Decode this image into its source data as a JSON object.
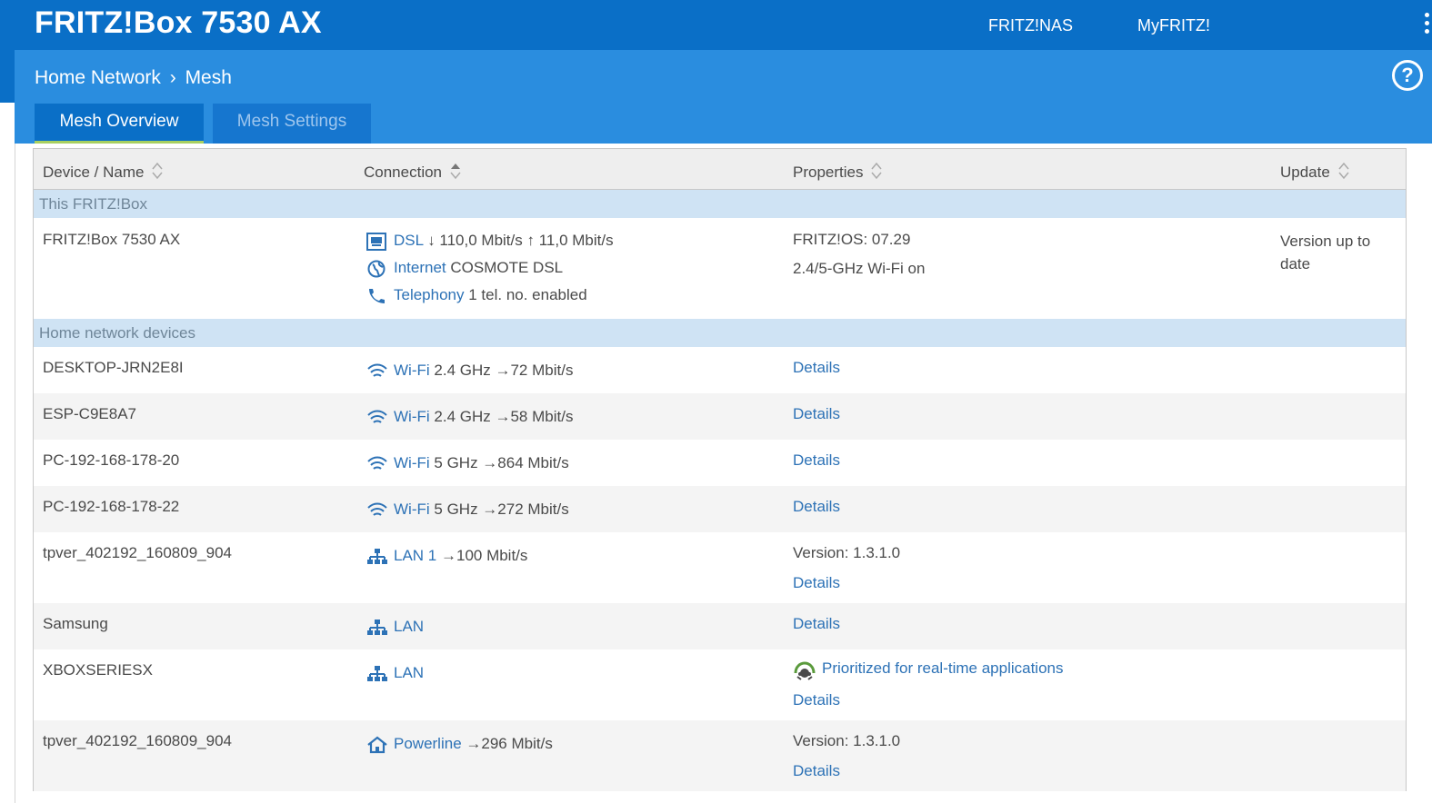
{
  "app": {
    "title": "FRITZ!Box 7530 AX"
  },
  "topnav": {
    "fritznas": "FRITZ!NAS",
    "myfritz": "MyFRITZ!"
  },
  "breadcrumb": {
    "parent": "Home Network",
    "separator": "›",
    "current": "Mesh"
  },
  "help": {
    "label": "?"
  },
  "tabs": [
    {
      "label": "Mesh Overview",
      "active": true
    },
    {
      "label": "Mesh Settings",
      "active": false
    }
  ],
  "table": {
    "headers": {
      "device": "Device / Name",
      "connection": "Connection",
      "properties": "Properties",
      "update": "Update"
    },
    "sections": {
      "this_box": "This FRITZ!Box",
      "home_devices": "Home network devices"
    },
    "fritzbox": {
      "name": "FRITZ!Box 7530 AX",
      "conn": [
        {
          "icon": "dsl-icon",
          "label": "DSL",
          "value": "↓ 110,0 Mbit/s ↑ 11,0 Mbit/s"
        },
        {
          "icon": "globe-icon",
          "label": "Internet",
          "value": "COSMOTE DSL"
        },
        {
          "icon": "phone-icon",
          "label": "Telephony",
          "value": "1 tel. no. enabled"
        }
      ],
      "props": [
        "FRITZ!OS: 07.29",
        "2.4/5-GHz Wi-Fi on"
      ],
      "update": "Version up to date"
    },
    "devices": [
      {
        "name": "DESKTOP-JRN2E8I",
        "icon": "wifi-icon",
        "label": "Wi-Fi",
        "value": "2.4 GHz →72 Mbit/s",
        "props": [],
        "details": "Details"
      },
      {
        "name": "ESP-C9E8A7",
        "icon": "wifi-icon",
        "label": "Wi-Fi",
        "value": "2.4 GHz →58 Mbit/s",
        "props": [],
        "details": "Details"
      },
      {
        "name": "PC-192-168-178-20",
        "icon": "wifi-icon",
        "label": "Wi-Fi",
        "value": "5 GHz →864 Mbit/s",
        "props": [],
        "details": "Details"
      },
      {
        "name": "PC-192-168-178-22",
        "icon": "wifi-icon",
        "label": "Wi-Fi",
        "value": "5 GHz →272 Mbit/s",
        "props": [],
        "details": "Details"
      },
      {
        "name": "tpver_402192_160809_904",
        "icon": "lan-icon",
        "label": "LAN 1",
        "value": "→100 Mbit/s",
        "props": [
          "Version: 1.3.1.0"
        ],
        "details": "Details"
      },
      {
        "name": "Samsung",
        "icon": "lan-icon",
        "label": "LAN",
        "value": "",
        "props": [],
        "details": "Details"
      },
      {
        "name": "XBOXSERIESX",
        "icon": "lan-icon",
        "label": "LAN",
        "value": "",
        "props": [
          "Prioritized for real-time applications"
        ],
        "details": "Details"
      },
      {
        "name": "tpver_402192_160809_904",
        "icon": "home-icon",
        "label": "Powerline",
        "value": "→296 Mbit/s",
        "props": [
          "Version: 1.3.1.0"
        ],
        "details": "Details"
      }
    ]
  },
  "colors": {
    "header": "#0a6fc7",
    "subheader": "#2a8ddf",
    "tab_underline": "#a8d060",
    "link": "#2d72b6",
    "section": "#cfe3f4"
  }
}
